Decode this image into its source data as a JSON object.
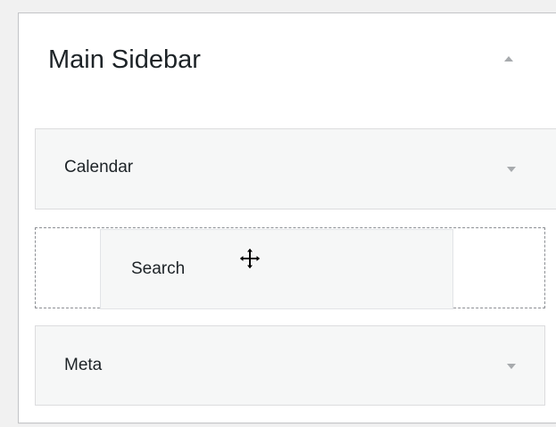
{
  "panel": {
    "title": "Main Sidebar",
    "toggle_icon": "arrow-up-icon"
  },
  "widgets": [
    {
      "title": "Calendar",
      "toggle_icon": "arrow-down-icon"
    },
    {
      "title": "Search",
      "state": "dragging"
    },
    {
      "title": "Meta",
      "toggle_icon": "arrow-down-icon"
    }
  ],
  "cursor": {
    "icon": "move-cursor-icon"
  },
  "colors": {
    "background": "#f1f1f1",
    "panel": "#ffffff",
    "widget": "#f6f7f7",
    "border": "#dcdcde",
    "placeholder_border": "#8c8f94",
    "arrow": "#a7aaad",
    "text": "#1d2327"
  }
}
